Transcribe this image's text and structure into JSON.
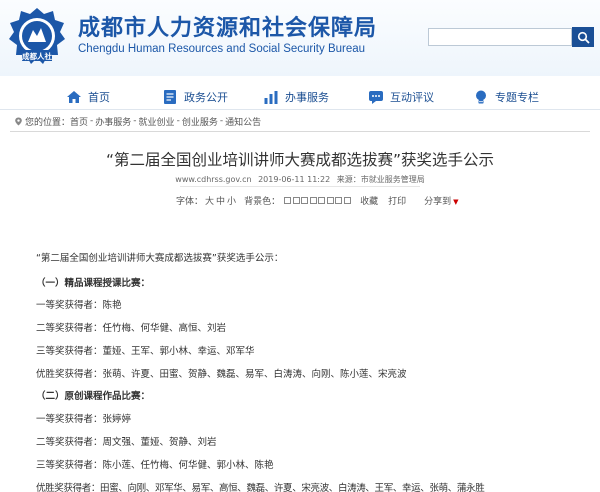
{
  "header": {
    "title": "成都市人力资源和社会保障局",
    "subtitle": "Chengdu Human Resources and Social Security Bureau",
    "logo_text": "成都人社",
    "search": {
      "placeholder": ""
    },
    "colors": {
      "brand": "#1c57a8",
      "search_button": "#1a4f96"
    }
  },
  "nav": {
    "items": [
      {
        "label": "首页",
        "icon": "home-icon"
      },
      {
        "label": "政务公开",
        "icon": "document-icon"
      },
      {
        "label": "办事服务",
        "icon": "bar-chart-icon"
      },
      {
        "label": "互动评议",
        "icon": "chat-icon"
      },
      {
        "label": "专题专栏",
        "icon": "lightbulb-icon"
      }
    ]
  },
  "breadcrumb": {
    "prefix": "您的位置：",
    "items": [
      "首页",
      "办事服务",
      "就业创业",
      "创业服务",
      "通知公告"
    ],
    "separator": "-"
  },
  "article": {
    "title": "“第二届全国创业培训讲师大赛成都选拔赛”获奖选手公示",
    "meta": {
      "site": "www.cdhrss.gov.cn",
      "date": "2019-06-11 11:22",
      "source": "来源：市就业服务管理局"
    },
    "tools": {
      "font_label": "字体：",
      "font_sizes": [
        "大",
        "中",
        "小"
      ],
      "bg_label": "背景色：",
      "swatches": [
        "#ffffff",
        "#ffffff",
        "#ffffff",
        "#ffffff",
        "#ffffff",
        "#ffffff",
        "#ffffff",
        "#ffffff"
      ],
      "favorite": "收藏",
      "print": "打印",
      "share": "分享到"
    },
    "body": [
      "“第二届全国创业培训讲师大赛成都选拔赛”获奖选手公示：",
      "（一）精品课程授课比赛：",
      "一等奖获得者：陈艳",
      "二等奖获得者：任竹梅、何华健、高恒、刘岩",
      "三等奖获得者：董娅、王军、郭小林、幸运、邓军华",
      "优胜奖获得者：张萌、许夏、田蜜、贺静、魏磊、易军、白涛涛、向刚、陈小莲、宋亮波",
      "（二）原创课程作品比赛：",
      "一等奖获得者：张婷婷",
      "二等奖获得者：周文强、董娅、贺静、刘岩",
      "三等奖获得者：陈小莲、任竹梅、何华健、郭小林、陈艳",
      "优胜奖获得者：田蜜、向刚、邓军华、易军、高恒、魏磊、许夏、宋亮波、白涛涛、王军、幸运、张萌、蒲永胜"
    ]
  }
}
